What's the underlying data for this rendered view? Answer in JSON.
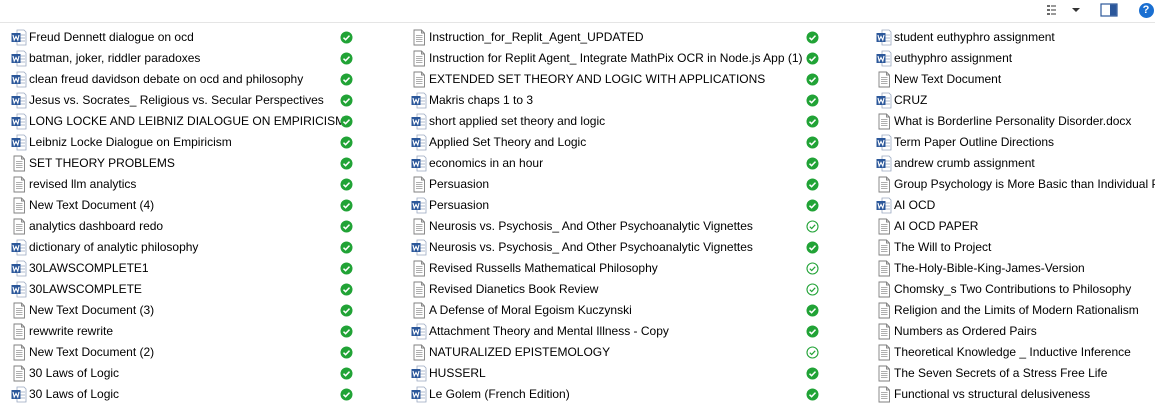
{
  "colors": {
    "ok_green": "#21a336",
    "word_blue": "#2b579a",
    "help_blue": "#1a6fd1"
  },
  "toolbar": {
    "help_label": "?",
    "view_icon": "view-options-icon",
    "pane_icon": "preview-pane-icon"
  },
  "columns": [
    {
      "items": [
        {
          "name": "Freud Dennett dialogue on ocd",
          "type": "word",
          "status": "synced"
        },
        {
          "name": "batman, joker, riddler paradoxes",
          "type": "word",
          "status": "synced"
        },
        {
          "name": "clean freud davidson debate on ocd and philosophy",
          "type": "word",
          "status": "synced"
        },
        {
          "name": "Jesus vs. Socrates_ Religious vs. Secular Perspectives",
          "type": "word",
          "status": "synced"
        },
        {
          "name": "LONG LOCKE AND LEIBNIZ DIALOGUE ON EMPIRICISM",
          "type": "word",
          "status": "synced"
        },
        {
          "name": "Leibniz Locke Dialogue on Empiricism",
          "type": "word",
          "status": "synced"
        },
        {
          "name": "SET THEORY PROBLEMS",
          "type": "text",
          "status": "synced"
        },
        {
          "name": "revised llm analytics",
          "type": "text",
          "status": "synced"
        },
        {
          "name": "New Text Document (4)",
          "type": "text",
          "status": "synced"
        },
        {
          "name": "analytics dashboard redo",
          "type": "text",
          "status": "synced"
        },
        {
          "name": "dictionary of analytic philosophy",
          "type": "word",
          "status": "synced"
        },
        {
          "name": "30LAWSCOMPLETE1",
          "type": "word",
          "status": "synced"
        },
        {
          "name": "30LAWSCOMPLETE",
          "type": "word",
          "status": "synced"
        },
        {
          "name": "New Text Document (3)",
          "type": "text",
          "status": "synced"
        },
        {
          "name": "rewwrite rewrite",
          "type": "text",
          "status": "synced"
        },
        {
          "name": "New Text Document (2)",
          "type": "text",
          "status": "synced"
        },
        {
          "name": "30 Laws of Logic",
          "type": "text",
          "status": "synced"
        },
        {
          "name": "30 Laws of Logic",
          "type": "word",
          "status": "synced"
        }
      ]
    },
    {
      "items": [
        {
          "name": "Instruction_for_Replit_Agent_UPDATED",
          "type": "text",
          "status": "synced"
        },
        {
          "name": "Instruction for Replit Agent_ Integrate MathPix OCR in Node.js App (1)",
          "type": "text",
          "status": "synced"
        },
        {
          "name": "EXTENDED SET THEORY AND LOGIC WITH APPLICATIONS",
          "type": "text",
          "status": "synced"
        },
        {
          "name": "Makris chaps 1 to 3",
          "type": "word",
          "status": "synced"
        },
        {
          "name": "short applied set theory and logic",
          "type": "word",
          "status": "synced"
        },
        {
          "name": "Applied Set Theory and Logic",
          "type": "word",
          "status": "synced"
        },
        {
          "name": "economics in an hour",
          "type": "word",
          "status": "synced"
        },
        {
          "name": "Persuasion",
          "type": "text",
          "status": "synced"
        },
        {
          "name": "Persuasion",
          "type": "word",
          "status": "synced"
        },
        {
          "name": "Neurosis vs. Psychosis_ And Other Psychoanalytic Vignettes",
          "type": "text",
          "status": "available"
        },
        {
          "name": "Neurosis vs. Psychosis_ And Other Psychoanalytic Vignettes",
          "type": "word",
          "status": "synced"
        },
        {
          "name": "Revised Russells Mathematical Philosophy",
          "type": "text",
          "status": "available"
        },
        {
          "name": "Revised Dianetics Book Review",
          "type": "text",
          "status": "available"
        },
        {
          "name": "A Defense of Moral Egoism Kuczynski",
          "type": "text",
          "status": "synced"
        },
        {
          "name": "Attachment Theory and Mental Illness - Copy",
          "type": "word",
          "status": "synced"
        },
        {
          "name": "NATURALIZED EPISTEMOLOGY",
          "type": "text",
          "status": "available"
        },
        {
          "name": "HUSSERL",
          "type": "word",
          "status": "synced"
        },
        {
          "name": "Le Golem (French Edition)",
          "type": "word",
          "status": "synced"
        }
      ]
    },
    {
      "items": [
        {
          "name": "student euthyphro assignment",
          "type": "word"
        },
        {
          "name": "euthyphro assignment",
          "type": "word"
        },
        {
          "name": "New Text Document",
          "type": "text"
        },
        {
          "name": "CRUZ",
          "type": "word"
        },
        {
          "name": "What is Borderline Personality Disorder.docx",
          "type": "text"
        },
        {
          "name": "Term Paper Outline Directions",
          "type": "word"
        },
        {
          "name": "andrew crumb assignment",
          "type": "word"
        },
        {
          "name": "Group Psychology is More Basic than Individual Psychology",
          "type": "text"
        },
        {
          "name": "AI OCD",
          "type": "word"
        },
        {
          "name": "AI OCD PAPER",
          "type": "text"
        },
        {
          "name": "The Will to Project",
          "type": "text"
        },
        {
          "name": "The-Holy-Bible-King-James-Version",
          "type": "text"
        },
        {
          "name": "Chomsky_s Two Contributions to Philosophy",
          "type": "text"
        },
        {
          "name": "Religion and the Limits of Modern Rationalism",
          "type": "text"
        },
        {
          "name": "Numbers as Ordered Pairs",
          "type": "text"
        },
        {
          "name": "Theoretical Knowledge _ Inductive Inference",
          "type": "text"
        },
        {
          "name": "The Seven Secrets of a Stress Free Life",
          "type": "text"
        },
        {
          "name": "Functional vs structural delusiveness",
          "type": "text"
        }
      ]
    }
  ]
}
